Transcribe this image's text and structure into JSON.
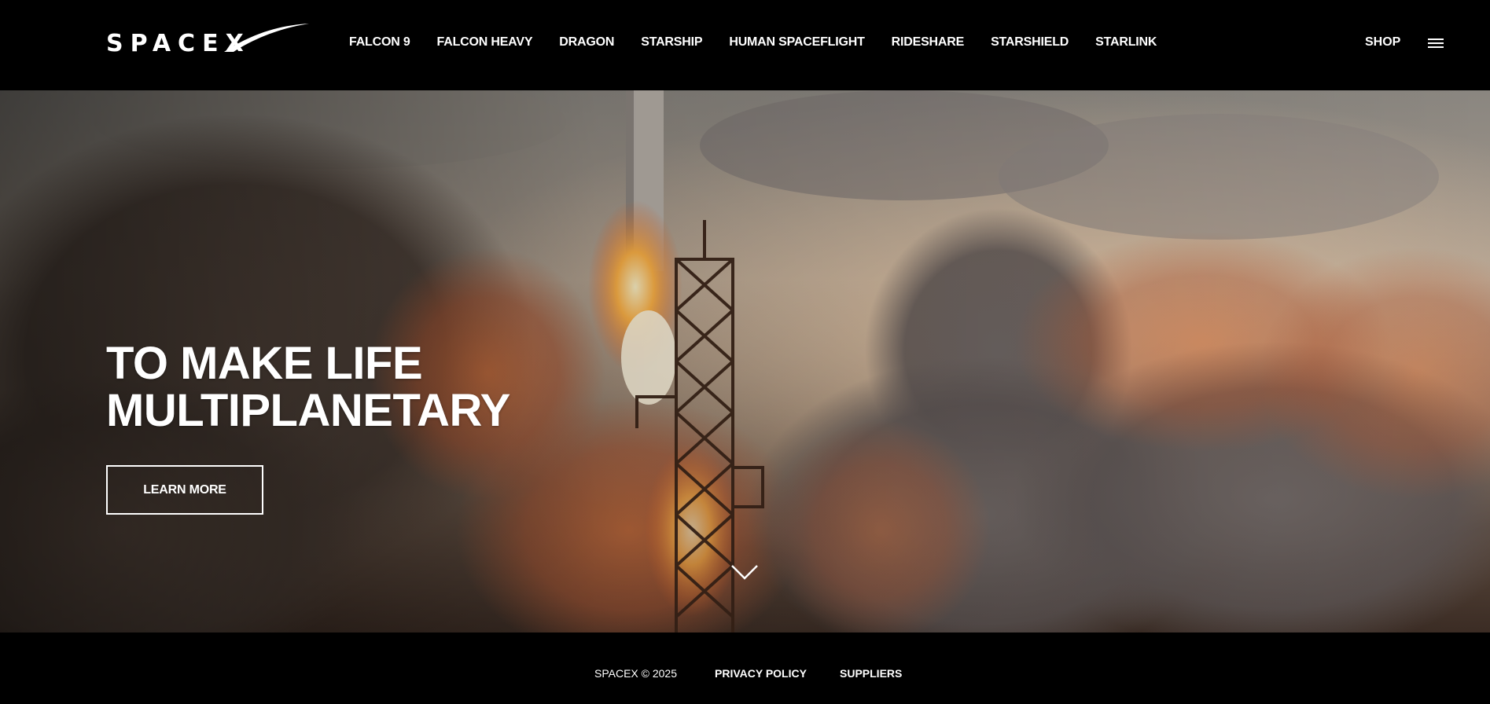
{
  "header": {
    "logo_text": "SPACEX",
    "nav": [
      "FALCON 9",
      "FALCON HEAVY",
      "DRAGON",
      "STARSHIP",
      "HUMAN SPACEFLIGHT",
      "RIDESHARE",
      "STARSHIELD",
      "STARLINK"
    ],
    "shop_label": "SHOP",
    "menu_icon": "hamburger-menu-icon"
  },
  "hero": {
    "title": "TO MAKE LIFE\nMULTIPLANETARY",
    "cta_label": "LEARN MORE",
    "scroll_icon": "chevron-down-icon"
  },
  "footer": {
    "copyright": "SPACEX © 2025",
    "links": [
      "PRIVACY POLICY",
      "SUPPLIERS"
    ]
  },
  "colors": {
    "background": "#000000",
    "text": "#ffffff"
  }
}
